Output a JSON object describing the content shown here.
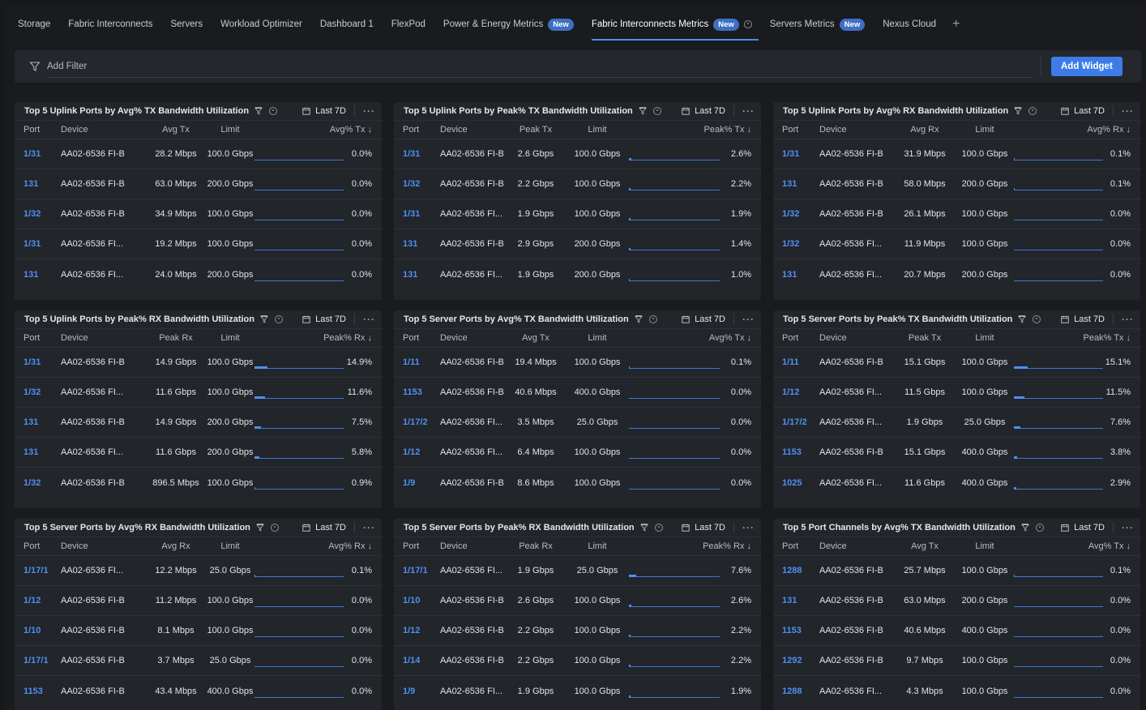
{
  "tabs": [
    {
      "label": "Storage"
    },
    {
      "label": "Fabric Interconnects"
    },
    {
      "label": "Servers"
    },
    {
      "label": "Workload Optimizer"
    },
    {
      "label": "Dashboard 1"
    },
    {
      "label": "FlexPod"
    },
    {
      "label": "Power & Energy Metrics",
      "badge": "New"
    },
    {
      "label": "Fabric Interconnects Metrics",
      "badge": "New",
      "active": true
    },
    {
      "label": "Servers Metrics",
      "badge": "New"
    },
    {
      "label": "Nexus Cloud"
    }
  ],
  "filter": {
    "placeholder": "Add Filter",
    "add_widget_label": "Add Widget"
  },
  "widgets": [
    {
      "title": "Top 5 Uplink Ports by Avg% TX Bandwidth Utilization",
      "range": "Last 7D",
      "more": "···",
      "columns": {
        "port": "Port",
        "device": "Device",
        "value": "Avg Tx",
        "limit": "Limit",
        "pct": "Avg% Tx ↓"
      },
      "rows": [
        {
          "port": "1/31",
          "device": "AA02-6536 FI-B",
          "value": "28.2 Mbps",
          "limit": "100.0 Gbps",
          "pct": "0.0%",
          "fraction": 0.0
        },
        {
          "port": "131",
          "device": "AA02-6536 FI-B",
          "value": "63.0 Mbps",
          "limit": "200.0 Gbps",
          "pct": "0.0%",
          "fraction": 0.0
        },
        {
          "port": "1/32",
          "device": "AA02-6536 FI-B",
          "value": "34.9 Mbps",
          "limit": "100.0 Gbps",
          "pct": "0.0%",
          "fraction": 0.0
        },
        {
          "port": "1/31",
          "device": "AA02-6536 FI...",
          "value": "19.2 Mbps",
          "limit": "100.0 Gbps",
          "pct": "0.0%",
          "fraction": 0.0
        },
        {
          "port": "131",
          "device": "AA02-6536 FI...",
          "value": "24.0 Mbps",
          "limit": "200.0 Gbps",
          "pct": "0.0%",
          "fraction": 0.0
        }
      ]
    },
    {
      "title": "Top 5 Uplink Ports by Peak% TX Bandwidth Utilization",
      "range": "Last 7D",
      "more": "···",
      "columns": {
        "port": "Port",
        "device": "Device",
        "value": "Peak Tx",
        "limit": "Limit",
        "pct": "Peak% Tx ↓"
      },
      "rows": [
        {
          "port": "1/31",
          "device": "AA02-6536 FI-B",
          "value": "2.6 Gbps",
          "limit": "100.0 Gbps",
          "pct": "2.6%",
          "fraction": 0.026
        },
        {
          "port": "1/32",
          "device": "AA02-6536 FI-B",
          "value": "2.2 Gbps",
          "limit": "100.0 Gbps",
          "pct": "2.2%",
          "fraction": 0.022
        },
        {
          "port": "1/31",
          "device": "AA02-6536 FI...",
          "value": "1.9 Gbps",
          "limit": "100.0 Gbps",
          "pct": "1.9%",
          "fraction": 0.019
        },
        {
          "port": "131",
          "device": "AA02-6536 FI-B",
          "value": "2.9 Gbps",
          "limit": "200.0 Gbps",
          "pct": "1.4%",
          "fraction": 0.014
        },
        {
          "port": "131",
          "device": "AA02-6536 FI...",
          "value": "1.9 Gbps",
          "limit": "200.0 Gbps",
          "pct": "1.0%",
          "fraction": 0.01
        }
      ]
    },
    {
      "title": "Top 5 Uplink Ports by Avg% RX Bandwidth Utilization",
      "range": "Last 7D",
      "more": "···",
      "columns": {
        "port": "Port",
        "device": "Device",
        "value": "Avg Rx",
        "limit": "Limit",
        "pct": "Avg% Rx ↓"
      },
      "rows": [
        {
          "port": "1/31",
          "device": "AA02-6536 FI-B",
          "value": "31.9 Mbps",
          "limit": "100.0 Gbps",
          "pct": "0.1%",
          "fraction": 0.001
        },
        {
          "port": "131",
          "device": "AA02-6536 FI-B",
          "value": "58.0 Mbps",
          "limit": "200.0 Gbps",
          "pct": "0.1%",
          "fraction": 0.001
        },
        {
          "port": "1/32",
          "device": "AA02-6536 FI-B",
          "value": "26.1 Mbps",
          "limit": "100.0 Gbps",
          "pct": "0.0%",
          "fraction": 0.0
        },
        {
          "port": "1/32",
          "device": "AA02-6536 FI...",
          "value": "11.9 Mbps",
          "limit": "100.0 Gbps",
          "pct": "0.0%",
          "fraction": 0.0
        },
        {
          "port": "131",
          "device": "AA02-6536 FI...",
          "value": "20.7 Mbps",
          "limit": "200.0 Gbps",
          "pct": "0.0%",
          "fraction": 0.0
        }
      ]
    },
    {
      "title": "Top 5 Uplink Ports by Peak% RX Bandwidth Utilization",
      "range": "Last 7D",
      "more": "···",
      "columns": {
        "port": "Port",
        "device": "Device",
        "value": "Peak Rx",
        "limit": "Limit",
        "pct": "Peak% Rx ↓"
      },
      "rows": [
        {
          "port": "1/31",
          "device": "AA02-6536 FI-B",
          "value": "14.9 Gbps",
          "limit": "100.0 Gbps",
          "pct": "14.9%",
          "fraction": 0.149
        },
        {
          "port": "1/32",
          "device": "AA02-6536 FI...",
          "value": "11.6 Gbps",
          "limit": "100.0 Gbps",
          "pct": "11.6%",
          "fraction": 0.116
        },
        {
          "port": "131",
          "device": "AA02-6536 FI-B",
          "value": "14.9 Gbps",
          "limit": "200.0 Gbps",
          "pct": "7.5%",
          "fraction": 0.075
        },
        {
          "port": "131",
          "device": "AA02-6536 FI...",
          "value": "11.6 Gbps",
          "limit": "200.0 Gbps",
          "pct": "5.8%",
          "fraction": 0.058
        },
        {
          "port": "1/32",
          "device": "AA02-6536 FI-B",
          "value": "896.5 Mbps",
          "limit": "100.0 Gbps",
          "pct": "0.9%",
          "fraction": 0.009
        }
      ]
    },
    {
      "title": "Top 5 Server Ports by Avg% TX Bandwidth Utilization",
      "range": "Last 7D",
      "more": "···",
      "columns": {
        "port": "Port",
        "device": "Device",
        "value": "Avg Tx",
        "limit": "Limit",
        "pct": "Avg% Tx ↓"
      },
      "rows": [
        {
          "port": "1/11",
          "device": "AA02-6536 FI-B",
          "value": "19.4 Mbps",
          "limit": "100.0 Gbps",
          "pct": "0.1%",
          "fraction": 0.001
        },
        {
          "port": "1153",
          "device": "AA02-6536 FI-B",
          "value": "40.6 Mbps",
          "limit": "400.0 Gbps",
          "pct": "0.0%",
          "fraction": 0.0
        },
        {
          "port": "1/17/2",
          "device": "AA02-6536 FI...",
          "value": "3.5 Mbps",
          "limit": "25.0 Gbps",
          "pct": "0.0%",
          "fraction": 0.0
        },
        {
          "port": "1/12",
          "device": "AA02-6536 FI...",
          "value": "6.4 Mbps",
          "limit": "100.0 Gbps",
          "pct": "0.0%",
          "fraction": 0.0
        },
        {
          "port": "1/9",
          "device": "AA02-6536 FI-B",
          "value": "8.6 Mbps",
          "limit": "100.0 Gbps",
          "pct": "0.0%",
          "fraction": 0.0
        }
      ]
    },
    {
      "title": "Top 5 Server Ports by Peak% TX Bandwidth Utilization",
      "range": "Last 7D",
      "more": "···",
      "columns": {
        "port": "Port",
        "device": "Device",
        "value": "Peak Tx",
        "limit": "Limit",
        "pct": "Peak% Tx ↓"
      },
      "rows": [
        {
          "port": "1/11",
          "device": "AA02-6536 FI-B",
          "value": "15.1 Gbps",
          "limit": "100.0 Gbps",
          "pct": "15.1%",
          "fraction": 0.151
        },
        {
          "port": "1/12",
          "device": "AA02-6536 FI...",
          "value": "11.5 Gbps",
          "limit": "100.0 Gbps",
          "pct": "11.5%",
          "fraction": 0.115
        },
        {
          "port": "1/17/2",
          "device": "AA02-6536 FI...",
          "value": "1.9 Gbps",
          "limit": "25.0 Gbps",
          "pct": "7.6%",
          "fraction": 0.076
        },
        {
          "port": "1153",
          "device": "AA02-6536 FI-B",
          "value": "15.1 Gbps",
          "limit": "400.0 Gbps",
          "pct": "3.8%",
          "fraction": 0.038
        },
        {
          "port": "1025",
          "device": "AA02-6536 FI...",
          "value": "11.6 Gbps",
          "limit": "400.0 Gbps",
          "pct": "2.9%",
          "fraction": 0.029
        }
      ]
    },
    {
      "title": "Top 5 Server Ports by Avg% RX Bandwidth Utilization",
      "range": "Last 7D",
      "more": "···",
      "columns": {
        "port": "Port",
        "device": "Device",
        "value": "Avg Rx",
        "limit": "Limit",
        "pct": "Avg% Rx ↓"
      },
      "rows": [
        {
          "port": "1/17/1",
          "device": "AA02-6536 FI...",
          "value": "12.2 Mbps",
          "limit": "25.0 Gbps",
          "pct": "0.1%",
          "fraction": 0.001
        },
        {
          "port": "1/12",
          "device": "AA02-6536 FI-B",
          "value": "11.2 Mbps",
          "limit": "100.0 Gbps",
          "pct": "0.0%",
          "fraction": 0.0
        },
        {
          "port": "1/10",
          "device": "AA02-6536 FI-B",
          "value": "8.1 Mbps",
          "limit": "100.0 Gbps",
          "pct": "0.0%",
          "fraction": 0.0
        },
        {
          "port": "1/17/1",
          "device": "AA02-6536 FI-B",
          "value": "3.7 Mbps",
          "limit": "25.0 Gbps",
          "pct": "0.0%",
          "fraction": 0.0
        },
        {
          "port": "1153",
          "device": "AA02-6536 FI-B",
          "value": "43.4 Mbps",
          "limit": "400.0 Gbps",
          "pct": "0.0%",
          "fraction": 0.0
        }
      ]
    },
    {
      "title": "Top 5 Server Ports by Peak% RX Bandwidth Utilization",
      "range": "Last 7D",
      "more": "···",
      "columns": {
        "port": "Port",
        "device": "Device",
        "value": "Peak Rx",
        "limit": "Limit",
        "pct": "Peak% Rx ↓"
      },
      "rows": [
        {
          "port": "1/17/1",
          "device": "AA02-6536 FI...",
          "value": "1.9 Gbps",
          "limit": "25.0 Gbps",
          "pct": "7.6%",
          "fraction": 0.076
        },
        {
          "port": "1/10",
          "device": "AA02-6536 FI-B",
          "value": "2.6 Gbps",
          "limit": "100.0 Gbps",
          "pct": "2.6%",
          "fraction": 0.026
        },
        {
          "port": "1/12",
          "device": "AA02-6536 FI-B",
          "value": "2.2 Gbps",
          "limit": "100.0 Gbps",
          "pct": "2.2%",
          "fraction": 0.022
        },
        {
          "port": "1/14",
          "device": "AA02-6536 FI-B",
          "value": "2.2 Gbps",
          "limit": "100.0 Gbps",
          "pct": "2.2%",
          "fraction": 0.022
        },
        {
          "port": "1/9",
          "device": "AA02-6536 FI...",
          "value": "1.9 Gbps",
          "limit": "100.0 Gbps",
          "pct": "1.9%",
          "fraction": 0.019
        }
      ]
    },
    {
      "title": "Top 5 Port Channels by Avg% TX Bandwidth Utilization",
      "range": "Last 7D",
      "more": "···",
      "columns": {
        "port": "Port",
        "device": "Device",
        "value": "Avg Tx",
        "limit": "Limit",
        "pct": "Avg% Tx ↓"
      },
      "rows": [
        {
          "port": "1288",
          "device": "AA02-6536 FI-B",
          "value": "25.7 Mbps",
          "limit": "100.0 Gbps",
          "pct": "0.1%",
          "fraction": 0.001
        },
        {
          "port": "131",
          "device": "AA02-6536 FI-B",
          "value": "63.0 Mbps",
          "limit": "200.0 Gbps",
          "pct": "0.0%",
          "fraction": 0.0
        },
        {
          "port": "1153",
          "device": "AA02-6536 FI-B",
          "value": "40.6 Mbps",
          "limit": "400.0 Gbps",
          "pct": "0.0%",
          "fraction": 0.0
        },
        {
          "port": "1292",
          "device": "AA02-6536 FI-B",
          "value": "9.7 Mbps",
          "limit": "100.0 Gbps",
          "pct": "0.0%",
          "fraction": 0.0
        },
        {
          "port": "1288",
          "device": "AA02-6536 FI...",
          "value": "4.3 Mbps",
          "limit": "100.0 Gbps",
          "pct": "0.0%",
          "fraction": 0.0
        }
      ]
    }
  ]
}
